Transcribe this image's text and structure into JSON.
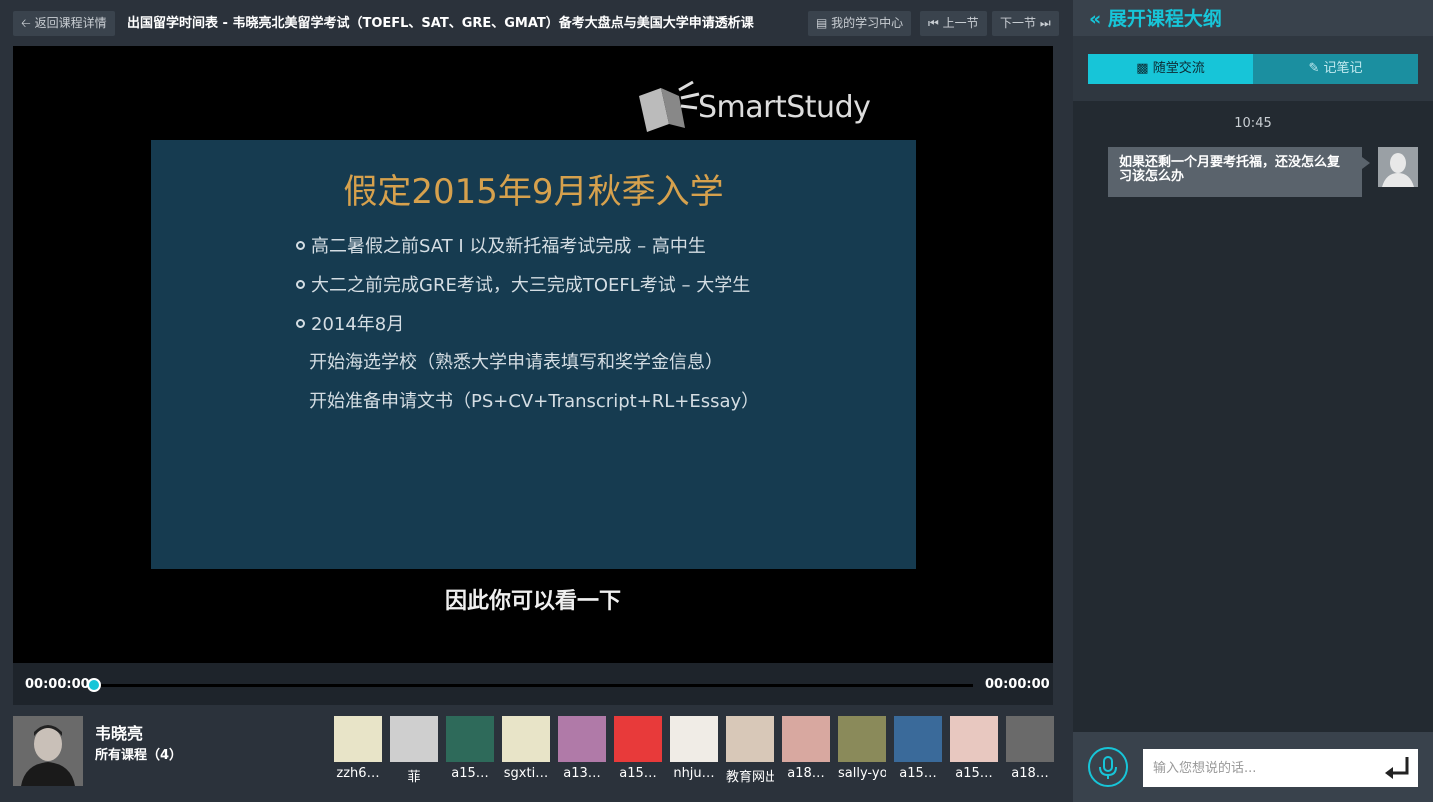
{
  "topbar": {
    "back_label": "返回课程详情",
    "course_title": "出国留学时间表 - 韦晓亮北美留学考试（TOEFL、SAT、GRE、GMAT）备考大盘点与美国大学申请透析课",
    "study_center_label": "我的学习中心",
    "prev_label": "上一节",
    "next_label": "下一节"
  },
  "video": {
    "logo_text": "SmartStudy",
    "slide": {
      "title": "假定2015年9月秋季入学",
      "bullets": [
        "高二暑假之前SAT I 以及新托福考试完成 – 高中生",
        "大二之前完成GRE考试，大三完成TOEFL考试 – 大学生",
        "2014年8月"
      ],
      "subs": [
        "开始海选学校（熟悉大学申请表填写和奖学金信息）",
        "开始准备申请文书（PS+CV+Transcript+RL+Essay）"
      ]
    },
    "caption": "因此你可以看一下"
  },
  "player": {
    "current_time": "00:00:00",
    "total_time": "00:00:00",
    "progress": 0
  },
  "teacher": {
    "name": "韦晓亮",
    "courses": "所有课程（4）"
  },
  "students": [
    {
      "name": "zzh6…",
      "color": "#e8e4c8"
    },
    {
      "name": "菲",
      "color": "#cfcfcf"
    },
    {
      "name": "a15…",
      "color": "#2e6a5a"
    },
    {
      "name": "sgxti…",
      "color": "#e8e4c8"
    },
    {
      "name": "a13…",
      "color": "#b07aa8"
    },
    {
      "name": "a15…",
      "color": "#e83a3a"
    },
    {
      "name": "nhju…",
      "color": "#f0ece6"
    },
    {
      "name": "教育网出铭",
      "color": "#d8c8b8"
    },
    {
      "name": "a18…",
      "color": "#d8a8a0"
    },
    {
      "name": "sally-you",
      "color": "#8a8a5a"
    },
    {
      "name": "a15…",
      "color": "#3a6a9a"
    },
    {
      "name": "a15…",
      "color": "#e8c8c0"
    },
    {
      "name": "a18…",
      "color": "#6a6a6a"
    }
  ],
  "sidebar": {
    "outline_label": "展开课程大纲",
    "tab_chat": "随堂交流",
    "tab_notes": "记笔记",
    "chat": {
      "time": "10:45",
      "message": "如果还剩一个月要考托福，还没怎么复习该怎么办"
    },
    "input_placeholder": "输入您想说的话..."
  },
  "colors": {
    "accent": "#17c5d8",
    "tab_inactive": "#1b8fa0",
    "slide_bg": "#163b50",
    "slide_title": "#d6a14d"
  }
}
